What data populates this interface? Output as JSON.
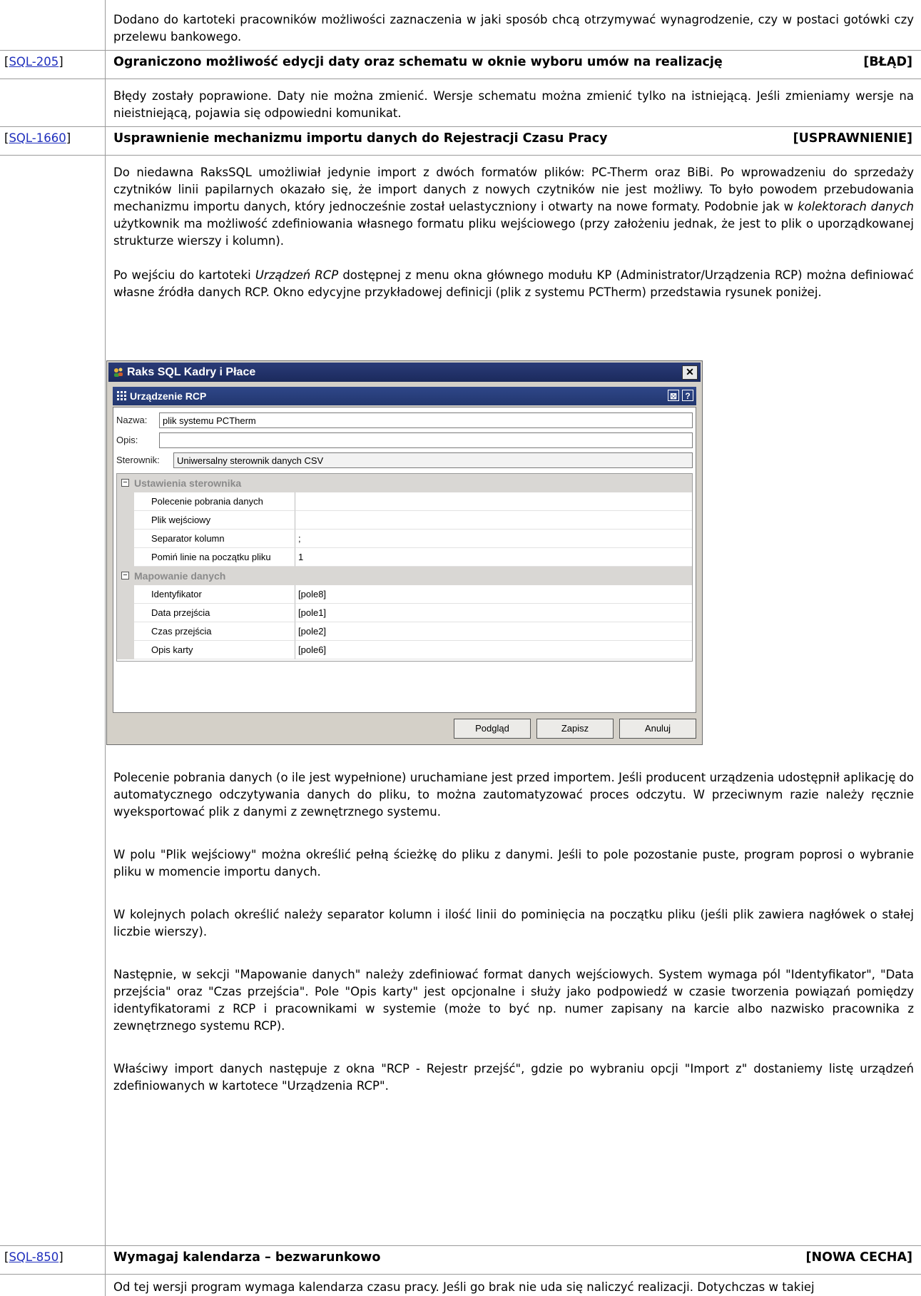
{
  "row0": {
    "text": "Dodano do kartoteki pracowników możliwości zaznaczenia w jaki sposób chcą otrzymywać wynagrodzenie, czy w postaci gotówki czy przelewu bankowego."
  },
  "issues": [
    {
      "id": "SQL-205",
      "title": "Ograniczono możliwość edycji daty oraz schematu w oknie wyboru umów na realizację",
      "tag": "[BŁĄD]",
      "body": "Błędy zostały poprawione. Daty nie można zmienić. Wersje schematu można zmienić tylko na istniejącą. Jeśli zmieniamy wersje na nieistniejącą, pojawia się odpowiedni komunikat."
    },
    {
      "id": "SQL-1660",
      "title": "Usprawnienie mechanizmu importu danych do Rejestracji Czasu Pracy",
      "tag": "[USPRAWNIENIE]",
      "p1_a": "Do niedawna RaksSQL umożliwiał jedynie import z dwóch formatów plików: PC-Therm oraz BiBi. Po wprowadzeniu do sprzedaży czytników linii papilarnych okazało się, że import danych z nowych czytników nie jest możliwy. To było powodem przebudowania mechanizmu importu danych, który jednocześnie został uelastyczniony i otwarty na nowe formaty. Podobnie jak w ",
      "p1_em": "kolektorach danych",
      "p1_b": " użytkownik ma możliwość zdefiniowania własnego formatu pliku wejściowego (przy założeniu jednak, że jest to plik o uporządkowanej strukturze wierszy i kolumn).",
      "p2_a": "Po wejściu do kartoteki ",
      "p2_em": "Urządzeń RCP",
      "p2_b": " dostępnej z menu okna głównego modułu KP (Administrator/Urządzenia RCP) można definiować własne źródła danych RCP. Okno edycyjne przykładowej definicji (plik z systemu PCTherm) przedstawia rysunek poniżej.",
      "p3": "Polecenie pobrania danych (o ile jest wypełnione) uruchamiane jest przed importem. Jeśli producent urządzenia udostępnił aplikację do automatycznego odczytywania danych do pliku, to można zautomatyzować proces odczytu. W przeciwnym razie należy ręcznie wyeksportować plik z danymi z zewnętrznego systemu.",
      "p4": "W polu \"Plik wejściowy\" można określić pełną ścieżkę do pliku z danymi. Jeśli to pole pozostanie puste, program poprosi o wybranie pliku w momencie importu danych.",
      "p5": "W kolejnych polach określić należy separator kolumn i ilość linii do pominięcia na początku pliku (jeśli plik zawiera nagłówek o stałej liczbie wierszy).",
      "p6": "Następnie, w sekcji \"Mapowanie danych\" należy zdefiniować format danych wejściowych. System wymaga pól \"Identyfikator\", \"Data przejścia\" oraz \"Czas przejścia\". Pole \"Opis karty\" jest opcjonalne i służy jako podpowiedź w czasie tworzenia powiązań pomiędzy identyfikatorami z RCP i pracownikami w systemie (może to być np. numer zapisany na karcie albo nazwisko pracownika z zewnętrznego systemu RCP).",
      "p7": "Właściwy import danych następuje z okna \"RCP - Rejestr przejść\", gdzie po wybraniu opcji \"Import z\" dostaniemy listę urządzeń zdefiniowanych w kartotece \"Urządzenia RCP\"."
    },
    {
      "id": "SQL-850",
      "title": "Wymagaj kalendarza – bezwarunkowo",
      "tag": "[NOWA CECHA]",
      "body": "Od tej wersji program wymaga kalendarza czasu pracy. Jeśli go brak nie uda się naliczyć realizacji. Dotychczas w takiej"
    }
  ],
  "window": {
    "app_title": "Raks SQL Kadry i Płace",
    "close_glyph": "✕",
    "form_title": "Urządzenie RCP",
    "restore_glyph": "⊠",
    "help_glyph": "?",
    "name_label": "Nazwa:",
    "name_value": "plik systemu PCTherm",
    "desc_label": "Opis:",
    "desc_value": "",
    "driver_label": "Sterownik:",
    "driver_value": "Uniwersalny sterownik danych CSV",
    "section1": "Ustawienia sterownika",
    "section2": "Mapowanie danych",
    "collapse_glyph": "−",
    "settings": [
      {
        "k": "Polecenie pobrania danych",
        "v": ""
      },
      {
        "k": "Plik wejściowy",
        "v": ""
      },
      {
        "k": "Separator kolumn",
        "v": ";"
      },
      {
        "k": "Pomiń linie na początku pliku",
        "v": "1"
      }
    ],
    "mapping": [
      {
        "k": "Identyfikator",
        "v": "[pole8]"
      },
      {
        "k": "Data przejścia",
        "v": "[pole1]"
      },
      {
        "k": "Czas przejścia",
        "v": "[pole2]"
      },
      {
        "k": "Opis karty",
        "v": "[pole6]"
      }
    ],
    "btn_preview": "Podgląd",
    "btn_save": "Zapisz",
    "btn_cancel": "Anuluj"
  }
}
